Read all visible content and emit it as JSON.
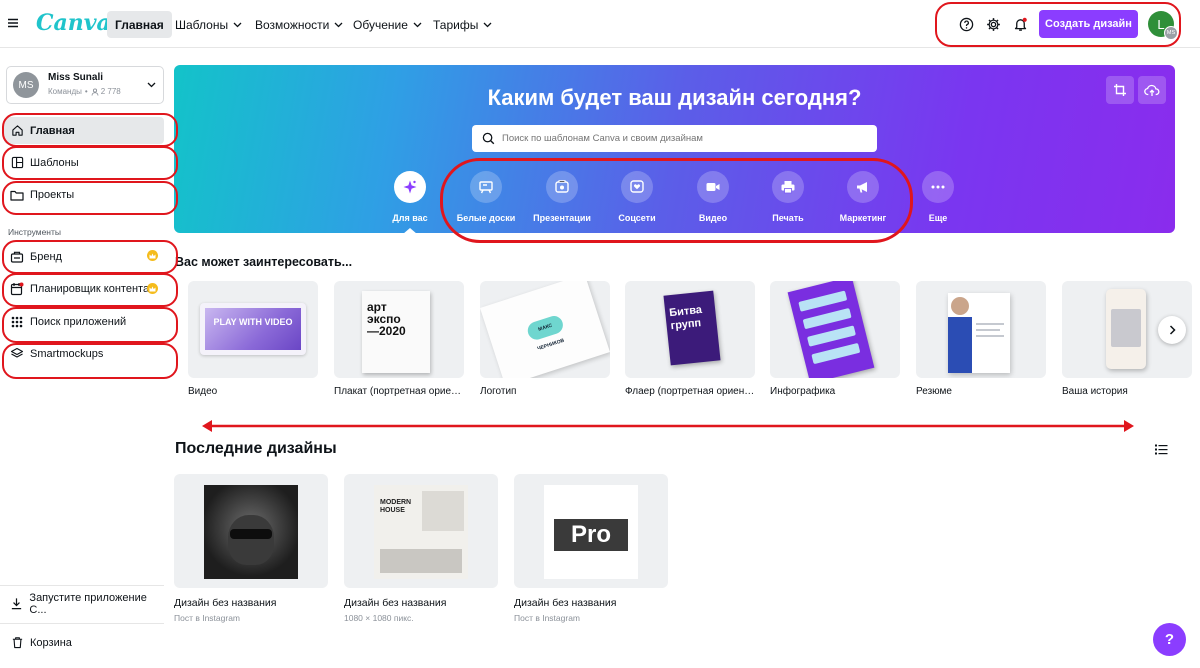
{
  "brand": {
    "logo_text": "Canva",
    "logo_color": "#20c4cb",
    "accent": "#8b3dff",
    "annotation_color": "#e0161d"
  },
  "nav": {
    "menu_icon": "hamburger-icon",
    "items": [
      {
        "label": "Главная",
        "active": true
      },
      {
        "label": "Шаблоны",
        "has_chevron": true
      },
      {
        "label": "Возможности",
        "has_chevron": true
      },
      {
        "label": "Обучение",
        "has_chevron": true
      },
      {
        "label": "Тарифы",
        "has_chevron": true
      }
    ],
    "create_button": "Создать дизайн",
    "avatar_letter": "L",
    "avatar_badge": "MS",
    "avatar_color": "#2f8f39",
    "icons": [
      "help-icon",
      "settings-icon",
      "bell-icon"
    ]
  },
  "sidebar": {
    "user": {
      "initials": "MS",
      "name": "Miss Sunali",
      "team_label": "Команды",
      "members": "2 778"
    },
    "main_items": [
      {
        "label": "Главная",
        "icon": "home-icon",
        "active": true
      },
      {
        "label": "Шаблоны",
        "icon": "templates-icon"
      },
      {
        "label": "Проекты",
        "icon": "folder-icon"
      }
    ],
    "tools_heading": "Инструменты",
    "tool_items": [
      {
        "label": "Бренд",
        "icon": "brand-kit-icon",
        "crown": true
      },
      {
        "label": "Планировщик контента",
        "icon": "calendar-icon",
        "crown": true,
        "dot": true
      },
      {
        "label": "Поиск приложений",
        "icon": "apps-grid-icon"
      },
      {
        "label": "Smartmockups",
        "icon": "layers-icon"
      }
    ],
    "bottom_items": [
      {
        "label": "Запустите приложение С...",
        "icon": "download-icon"
      },
      {
        "label": "Корзина",
        "icon": "trash-icon"
      }
    ]
  },
  "hero": {
    "title": "Каким будет ваш дизайн сегодня?",
    "search_placeholder": "Поиск по шаблонам Canva и своим дизайнам",
    "categories": [
      {
        "label": "Для вас",
        "icon": "sparkle-icon",
        "active": true
      },
      {
        "label": "Белые доски",
        "icon": "whiteboard-icon"
      },
      {
        "label": "Презентации",
        "icon": "presentation-icon"
      },
      {
        "label": "Соцсети",
        "icon": "heart-icon"
      },
      {
        "label": "Видео",
        "icon": "video-icon"
      },
      {
        "label": "Печать",
        "icon": "printer-icon"
      },
      {
        "label": "Маркетинг",
        "icon": "megaphone-icon"
      },
      {
        "label": "Еще",
        "icon": "more-icon"
      }
    ],
    "corner_icons": [
      "crop-icon",
      "upload-cloud-icon"
    ]
  },
  "suggestions": {
    "heading": "Вас может заинтересовать...",
    "cards": [
      {
        "label": "Видео",
        "thumb_text": "PLAY WITH VIDEO"
      },
      {
        "label": "Плакат (портретная ориентация)",
        "thumb_text": "арт экспо —2020"
      },
      {
        "label": "Логотип",
        "thumb_text": "МАКС ЧЕРНИКОВ"
      },
      {
        "label": "Флаер (портретная ориентация)",
        "thumb_text": "Битва групп"
      },
      {
        "label": "Инфографика",
        "thumb_text": ""
      },
      {
        "label": "Резюме",
        "thumb_text": ""
      },
      {
        "label": "Ваша история",
        "thumb_text": ""
      }
    ]
  },
  "recent": {
    "heading": "Последние дизайны",
    "items": [
      {
        "title": "Дизайн без названия",
        "subtitle": "Пост в Instagram",
        "thumb_text": ""
      },
      {
        "title": "Дизайн без названия",
        "subtitle": "1080 × 1080 пикс.",
        "thumb_text": "MODERN HOUSE"
      },
      {
        "title": "Дизайн без названия",
        "subtitle": "Пост в Instagram",
        "thumb_text": "Pro"
      }
    ]
  },
  "help_fab": "?"
}
